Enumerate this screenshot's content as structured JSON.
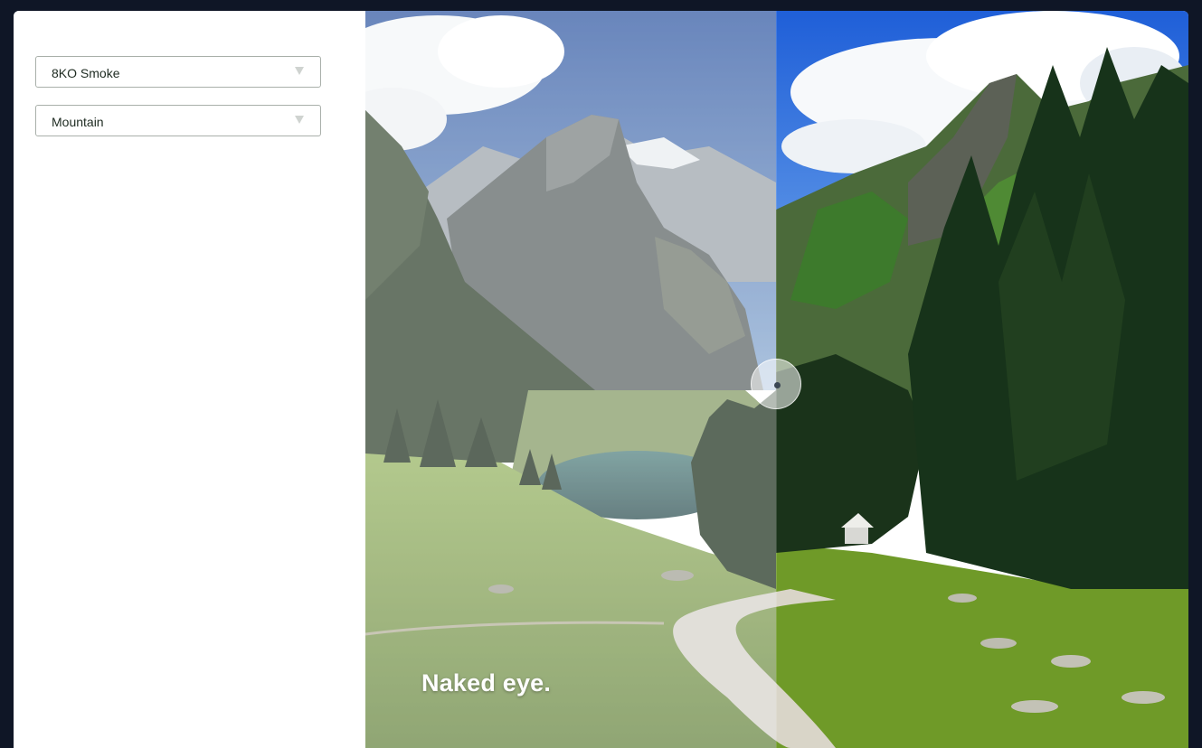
{
  "sidebar": {
    "filter_select": {
      "value": "8KO Smoke"
    },
    "scene_select": {
      "value": "Mountain"
    }
  },
  "viewer": {
    "caption": "Naked eye.",
    "comparison_split": 0.5
  },
  "colors": {
    "page_background": "#0f1626",
    "panel_background": "#ffffff",
    "select_border": "#a9b0aa"
  },
  "icons": {
    "select_arrow": "triangle-down-icon",
    "handle": "drag-handle-icon"
  }
}
